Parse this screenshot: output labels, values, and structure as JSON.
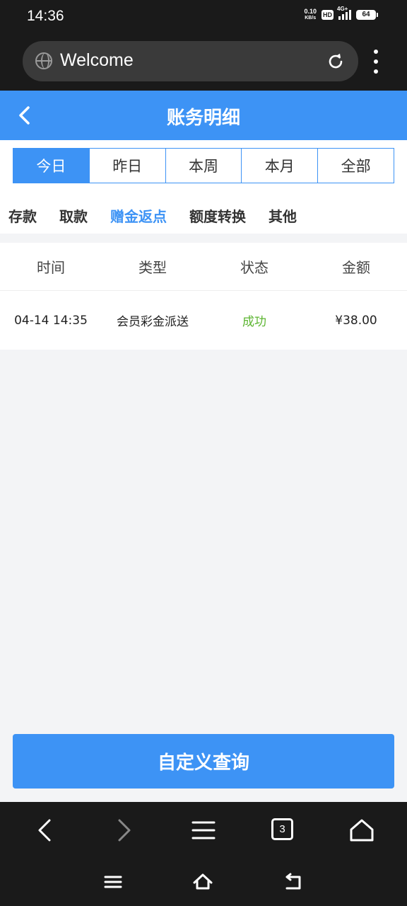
{
  "status_bar": {
    "time": "14:36",
    "net_speed_value": "0.10",
    "net_speed_unit": "KB/s",
    "hd_label": "HD",
    "network_label": "4G+",
    "battery_level": "64"
  },
  "browser": {
    "url_title": "Welcome",
    "tab_count": "3"
  },
  "header": {
    "title": "账务明细"
  },
  "period_tabs": [
    {
      "label": "今日",
      "active": true
    },
    {
      "label": "昨日",
      "active": false
    },
    {
      "label": "本周",
      "active": false
    },
    {
      "label": "本月",
      "active": false
    },
    {
      "label": "全部",
      "active": false
    }
  ],
  "category_tabs": [
    {
      "label": "存款",
      "active": false
    },
    {
      "label": "取款",
      "active": false
    },
    {
      "label": "赠金返点",
      "active": true
    },
    {
      "label": "额度转换",
      "active": false
    },
    {
      "label": "其他",
      "active": false
    }
  ],
  "table": {
    "headers": [
      "时间",
      "类型",
      "状态",
      "金额"
    ],
    "rows": [
      {
        "time": "04-14 14:35",
        "type": "会员彩金派送",
        "status": "成功",
        "amount": "¥38.00"
      }
    ]
  },
  "query_button": {
    "label": "自定义查询"
  },
  "colors": {
    "accent": "#3d93f5",
    "success": "#5cb531",
    "system_bar": "#1a1a1a",
    "page_bg": "#f3f4f6"
  },
  "icons": {
    "url_bar": [
      "globe-icon",
      "reload-icon",
      "more-vertical-icon"
    ],
    "header": [
      "back-chevron-icon"
    ],
    "browser_nav": [
      "back-arrow-icon",
      "forward-arrow-icon",
      "menu-icon",
      "tabs-icon",
      "home-icon"
    ],
    "system_nav": [
      "recents-icon",
      "home-icon",
      "back-icon"
    ]
  }
}
